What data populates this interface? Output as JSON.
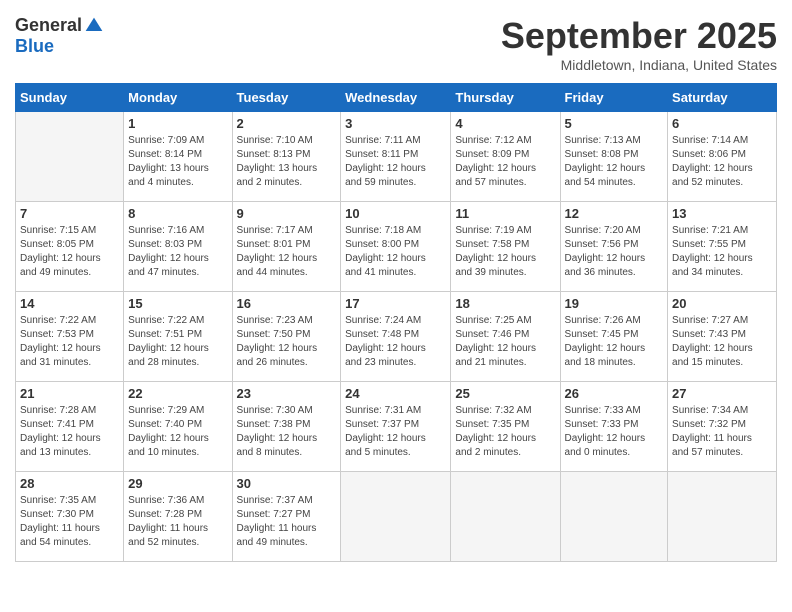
{
  "header": {
    "logo_general": "General",
    "logo_blue": "Blue",
    "month_title": "September 2025",
    "location": "Middletown, Indiana, United States"
  },
  "days_of_week": [
    "Sunday",
    "Monday",
    "Tuesday",
    "Wednesday",
    "Thursday",
    "Friday",
    "Saturday"
  ],
  "weeks": [
    [
      {
        "day": "",
        "info": ""
      },
      {
        "day": "1",
        "info": "Sunrise: 7:09 AM\nSunset: 8:14 PM\nDaylight: 13 hours\nand 4 minutes."
      },
      {
        "day": "2",
        "info": "Sunrise: 7:10 AM\nSunset: 8:13 PM\nDaylight: 13 hours\nand 2 minutes."
      },
      {
        "day": "3",
        "info": "Sunrise: 7:11 AM\nSunset: 8:11 PM\nDaylight: 12 hours\nand 59 minutes."
      },
      {
        "day": "4",
        "info": "Sunrise: 7:12 AM\nSunset: 8:09 PM\nDaylight: 12 hours\nand 57 minutes."
      },
      {
        "day": "5",
        "info": "Sunrise: 7:13 AM\nSunset: 8:08 PM\nDaylight: 12 hours\nand 54 minutes."
      },
      {
        "day": "6",
        "info": "Sunrise: 7:14 AM\nSunset: 8:06 PM\nDaylight: 12 hours\nand 52 minutes."
      }
    ],
    [
      {
        "day": "7",
        "info": "Sunrise: 7:15 AM\nSunset: 8:05 PM\nDaylight: 12 hours\nand 49 minutes."
      },
      {
        "day": "8",
        "info": "Sunrise: 7:16 AM\nSunset: 8:03 PM\nDaylight: 12 hours\nand 47 minutes."
      },
      {
        "day": "9",
        "info": "Sunrise: 7:17 AM\nSunset: 8:01 PM\nDaylight: 12 hours\nand 44 minutes."
      },
      {
        "day": "10",
        "info": "Sunrise: 7:18 AM\nSunset: 8:00 PM\nDaylight: 12 hours\nand 41 minutes."
      },
      {
        "day": "11",
        "info": "Sunrise: 7:19 AM\nSunset: 7:58 PM\nDaylight: 12 hours\nand 39 minutes."
      },
      {
        "day": "12",
        "info": "Sunrise: 7:20 AM\nSunset: 7:56 PM\nDaylight: 12 hours\nand 36 minutes."
      },
      {
        "day": "13",
        "info": "Sunrise: 7:21 AM\nSunset: 7:55 PM\nDaylight: 12 hours\nand 34 minutes."
      }
    ],
    [
      {
        "day": "14",
        "info": "Sunrise: 7:22 AM\nSunset: 7:53 PM\nDaylight: 12 hours\nand 31 minutes."
      },
      {
        "day": "15",
        "info": "Sunrise: 7:22 AM\nSunset: 7:51 PM\nDaylight: 12 hours\nand 28 minutes."
      },
      {
        "day": "16",
        "info": "Sunrise: 7:23 AM\nSunset: 7:50 PM\nDaylight: 12 hours\nand 26 minutes."
      },
      {
        "day": "17",
        "info": "Sunrise: 7:24 AM\nSunset: 7:48 PM\nDaylight: 12 hours\nand 23 minutes."
      },
      {
        "day": "18",
        "info": "Sunrise: 7:25 AM\nSunset: 7:46 PM\nDaylight: 12 hours\nand 21 minutes."
      },
      {
        "day": "19",
        "info": "Sunrise: 7:26 AM\nSunset: 7:45 PM\nDaylight: 12 hours\nand 18 minutes."
      },
      {
        "day": "20",
        "info": "Sunrise: 7:27 AM\nSunset: 7:43 PM\nDaylight: 12 hours\nand 15 minutes."
      }
    ],
    [
      {
        "day": "21",
        "info": "Sunrise: 7:28 AM\nSunset: 7:41 PM\nDaylight: 12 hours\nand 13 minutes."
      },
      {
        "day": "22",
        "info": "Sunrise: 7:29 AM\nSunset: 7:40 PM\nDaylight: 12 hours\nand 10 minutes."
      },
      {
        "day": "23",
        "info": "Sunrise: 7:30 AM\nSunset: 7:38 PM\nDaylight: 12 hours\nand 8 minutes."
      },
      {
        "day": "24",
        "info": "Sunrise: 7:31 AM\nSunset: 7:37 PM\nDaylight: 12 hours\nand 5 minutes."
      },
      {
        "day": "25",
        "info": "Sunrise: 7:32 AM\nSunset: 7:35 PM\nDaylight: 12 hours\nand 2 minutes."
      },
      {
        "day": "26",
        "info": "Sunrise: 7:33 AM\nSunset: 7:33 PM\nDaylight: 12 hours\nand 0 minutes."
      },
      {
        "day": "27",
        "info": "Sunrise: 7:34 AM\nSunset: 7:32 PM\nDaylight: 11 hours\nand 57 minutes."
      }
    ],
    [
      {
        "day": "28",
        "info": "Sunrise: 7:35 AM\nSunset: 7:30 PM\nDaylight: 11 hours\nand 54 minutes."
      },
      {
        "day": "29",
        "info": "Sunrise: 7:36 AM\nSunset: 7:28 PM\nDaylight: 11 hours\nand 52 minutes."
      },
      {
        "day": "30",
        "info": "Sunrise: 7:37 AM\nSunset: 7:27 PM\nDaylight: 11 hours\nand 49 minutes."
      },
      {
        "day": "",
        "info": ""
      },
      {
        "day": "",
        "info": ""
      },
      {
        "day": "",
        "info": ""
      },
      {
        "day": "",
        "info": ""
      }
    ]
  ]
}
